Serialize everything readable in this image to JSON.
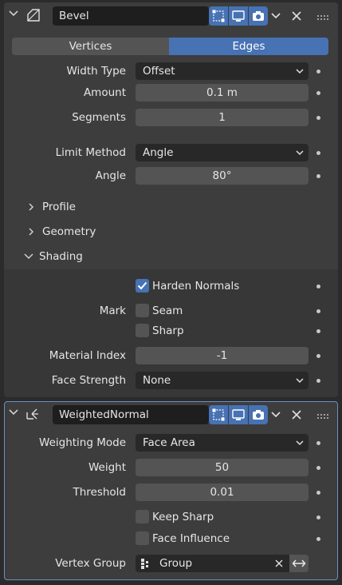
{
  "bevel": {
    "name": "Bevel",
    "affect_tabs": [
      "Vertices",
      "Edges"
    ],
    "active_tab": "Edges",
    "width_type_label": "Width Type",
    "width_type_value": "Offset",
    "amount_label": "Amount",
    "amount_value": "0.1 m",
    "segments_label": "Segments",
    "segments_value": "1",
    "limit_method_label": "Limit Method",
    "limit_method_value": "Angle",
    "angle_label": "Angle",
    "angle_value": "80°",
    "subpanels": [
      "Profile",
      "Geometry",
      "Shading"
    ],
    "harden_normals_label": "Harden Normals",
    "harden_normals_checked": true,
    "mark_label": "Mark",
    "seam_label": "Seam",
    "seam_checked": false,
    "sharp_label": "Sharp",
    "sharp_checked": false,
    "material_index_label": "Material Index",
    "material_index_value": "-1",
    "face_strength_label": "Face Strength",
    "face_strength_value": "None"
  },
  "weighted_normal": {
    "name": "WeightedNormal",
    "weighting_mode_label": "Weighting Mode",
    "weighting_mode_value": "Face Area",
    "weight_label": "Weight",
    "weight_value": "50",
    "threshold_label": "Threshold",
    "threshold_value": "0.01",
    "keep_sharp_label": "Keep Sharp",
    "keep_sharp_checked": false,
    "face_influence_label": "Face Influence",
    "face_influence_checked": false,
    "vertex_group_label": "Vertex Group",
    "vertex_group_value": "Group"
  },
  "colors": {
    "accent": "#4772b3",
    "panel": "#3d3d3d",
    "field": "#545454",
    "dropdown": "#282828",
    "active_border": "#6d8ebf"
  }
}
